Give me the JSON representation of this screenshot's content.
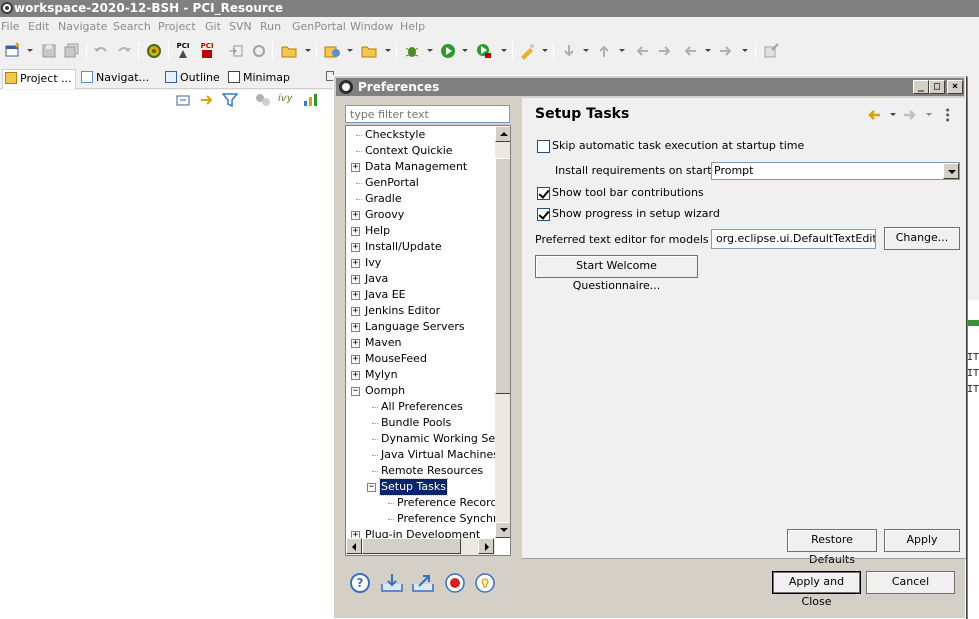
{
  "window": {
    "title": "workspace-2020-12-BSH - PCI_Resource"
  },
  "menu": [
    "File",
    "Edit",
    "Navigate",
    "Search",
    "Project",
    "Git",
    "SVN",
    "Run",
    "GenPortal",
    "Window",
    "Help"
  ],
  "view_tabs": [
    {
      "label": "Project ...",
      "icon": "project-explorer-icon"
    },
    {
      "label": "Navigat...",
      "icon": "navigator-icon"
    },
    {
      "label": "Outline",
      "icon": "outline-icon"
    },
    {
      "label": "Minimap",
      "icon": "minimap-icon"
    }
  ],
  "toolbar_icons": {
    "pci_label_1": "PCI",
    "pci_label_2": "PCI"
  },
  "dialog": {
    "title": "Preferences",
    "filter_placeholder": "type filter text",
    "tree": [
      {
        "label": "Checkstyle",
        "level": 0,
        "expander": "none"
      },
      {
        "label": "Context Quickie",
        "level": 0,
        "expander": "none"
      },
      {
        "label": "Data Management",
        "level": 0,
        "expander": "plus"
      },
      {
        "label": "GenPortal",
        "level": 0,
        "expander": "none"
      },
      {
        "label": "Gradle",
        "level": 0,
        "expander": "none"
      },
      {
        "label": "Groovy",
        "level": 0,
        "expander": "plus"
      },
      {
        "label": "Help",
        "level": 0,
        "expander": "plus"
      },
      {
        "label": "Install/Update",
        "level": 0,
        "expander": "plus"
      },
      {
        "label": "Ivy",
        "level": 0,
        "expander": "plus"
      },
      {
        "label": "Java",
        "level": 0,
        "expander": "plus"
      },
      {
        "label": "Java EE",
        "level": 0,
        "expander": "plus"
      },
      {
        "label": "Jenkins Editor",
        "level": 0,
        "expander": "plus"
      },
      {
        "label": "Language Servers",
        "level": 0,
        "expander": "plus"
      },
      {
        "label": "Maven",
        "level": 0,
        "expander": "plus"
      },
      {
        "label": "MouseFeed",
        "level": 0,
        "expander": "plus"
      },
      {
        "label": "Mylyn",
        "level": 0,
        "expander": "plus"
      },
      {
        "label": "Oomph",
        "level": 0,
        "expander": "minus"
      },
      {
        "label": "All Preferences",
        "level": 1,
        "expander": "none"
      },
      {
        "label": "Bundle Pools",
        "level": 1,
        "expander": "none"
      },
      {
        "label": "Dynamic Working Sets",
        "level": 1,
        "expander": "none"
      },
      {
        "label": "Java Virtual Machines",
        "level": 1,
        "expander": "none"
      },
      {
        "label": "Remote Resources",
        "level": 1,
        "expander": "none"
      },
      {
        "label": "Setup Tasks",
        "level": 1,
        "expander": "minus",
        "selected": true
      },
      {
        "label": "Preference Recorder",
        "level": 2,
        "expander": "none"
      },
      {
        "label": "Preference Synchronizer",
        "level": 2,
        "expander": "none"
      },
      {
        "label": "Plug-in Development",
        "level": 0,
        "expander": "plus"
      }
    ],
    "page": {
      "title": "Setup Tasks",
      "skip_auto_label": "Skip automatic task execution at startup time",
      "skip_auto_checked": false,
      "install_req_label": "Install requirements on startup",
      "install_req_value": "Prompt",
      "show_toolbar_label": "Show tool bar contributions",
      "show_toolbar_checked": true,
      "show_progress_label": "Show progress in setup wizard",
      "show_progress_checked": true,
      "pref_editor_label": "Preferred text editor for models",
      "pref_editor_value": "org.eclipse.ui.DefaultTextEditor",
      "change_button": "Change...",
      "welcome_button": "Start Welcome Questionnaire...",
      "restore_defaults_button": "Restore Defaults",
      "apply_button": "Apply"
    },
    "apply_close_button": "Apply and Close",
    "cancel_button": "Cancel",
    "window_buttons": {
      "minimize": "_",
      "maximize": "□",
      "close": "×"
    }
  }
}
